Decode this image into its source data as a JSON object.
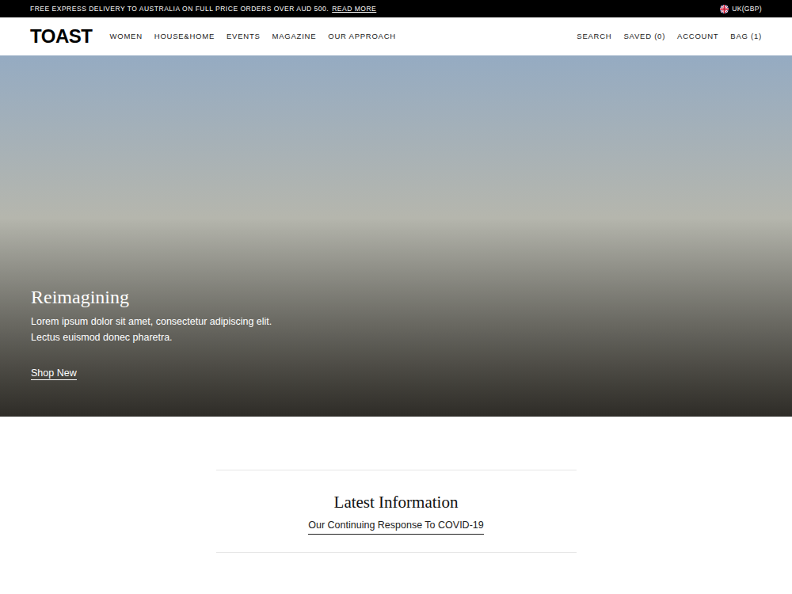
{
  "announcement": {
    "text": "FREE EXPRESS DELIVERY TO AUSTRALIA ON FULL PRICE ORDERS OVER AUD 500.",
    "link": "READ MORE",
    "currency": "UK(GBP)"
  },
  "header": {
    "logo": "TOAST",
    "nav": [
      "WOMEN",
      "HOUSE&HOME",
      "EVENTS",
      "MAGAZINE",
      "OUR APPROACH"
    ],
    "actions": [
      "SEARCH",
      "SAVED (0)",
      "ACCOUNT",
      "BAG (1)"
    ]
  },
  "hero": {
    "title": "Reimagining",
    "body": [
      "Lorem ipsum dolor sit amet, consectetur adipiscing elit.",
      "Lectus euismod donec pharetra."
    ],
    "cta": "Shop New"
  },
  "latest": {
    "title": "Latest Information",
    "link": "Our Continuing Response To COVID-19"
  }
}
